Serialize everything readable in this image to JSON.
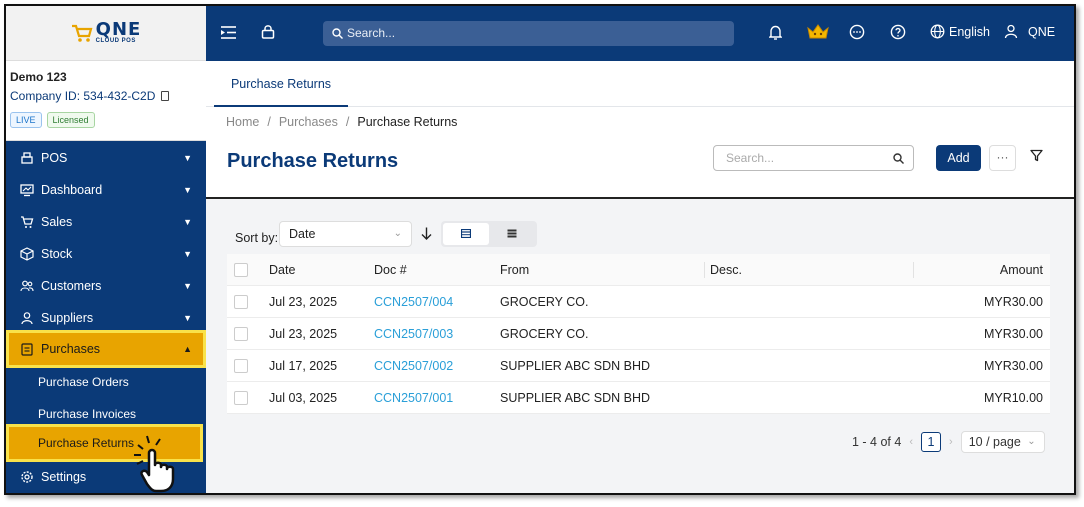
{
  "logo": {
    "brand": "QNE",
    "sub": "CLOUD POS"
  },
  "company": {
    "name": "Demo 123",
    "id_label": "Company ID: 534-432-C2D",
    "badge_live": "LIVE",
    "badge_licensed": "Licensed"
  },
  "sidebar": {
    "items": [
      {
        "label": "POS",
        "icon": "pos-icon"
      },
      {
        "label": "Dashboard",
        "icon": "dashboard-icon"
      },
      {
        "label": "Sales",
        "icon": "cart-icon"
      },
      {
        "label": "Stock",
        "icon": "box-icon"
      },
      {
        "label": "Customers",
        "icon": "customers-icon"
      },
      {
        "label": "Suppliers",
        "icon": "user-icon"
      },
      {
        "label": "Purchases",
        "icon": "clipboard-icon"
      },
      {
        "label": "Settings",
        "icon": "gear-icon"
      }
    ],
    "sub_items": [
      {
        "label": "Purchase Orders"
      },
      {
        "label": "Purchase Invoices"
      },
      {
        "label": "Purchase Returns"
      }
    ]
  },
  "topbar": {
    "search_placeholder": "Search...",
    "language": "English",
    "user": "QNE"
  },
  "tab": {
    "label": "Purchase Returns"
  },
  "breadcrumb": {
    "home": "Home",
    "purchases": "Purchases",
    "current": "Purchase Returns",
    "sep": "/"
  },
  "page": {
    "title": "Purchase Returns",
    "search_placeholder": "Search...",
    "add_label": "Add",
    "more_label": "···"
  },
  "sort": {
    "label": "Sort by:",
    "value": "Date"
  },
  "table": {
    "headers": {
      "date": "Date",
      "doc": "Doc #",
      "from": "From",
      "desc": "Desc.",
      "amount": "Amount"
    },
    "rows": [
      {
        "date": "Jul 23, 2025",
        "doc": "CCN2507/004",
        "from": "GROCERY CO.",
        "desc": "",
        "amount": "MYR30.00"
      },
      {
        "date": "Jul 23, 2025",
        "doc": "CCN2507/003",
        "from": "GROCERY CO.",
        "desc": "",
        "amount": "MYR30.00"
      },
      {
        "date": "Jul 17, 2025",
        "doc": "CCN2507/002",
        "from": "SUPPLIER ABC SDN BHD",
        "desc": "",
        "amount": "MYR30.00"
      },
      {
        "date": "Jul 03, 2025",
        "doc": "CCN2507/001",
        "from": "SUPPLIER ABC SDN BHD",
        "desc": "",
        "amount": "MYR10.00"
      }
    ]
  },
  "pagination": {
    "range": "1 - 4 of 4",
    "page": "1",
    "page_size": "10 / page"
  },
  "colors": {
    "primary": "#0b3a78",
    "highlight": "#e8a400",
    "link": "#2a9fd8"
  }
}
